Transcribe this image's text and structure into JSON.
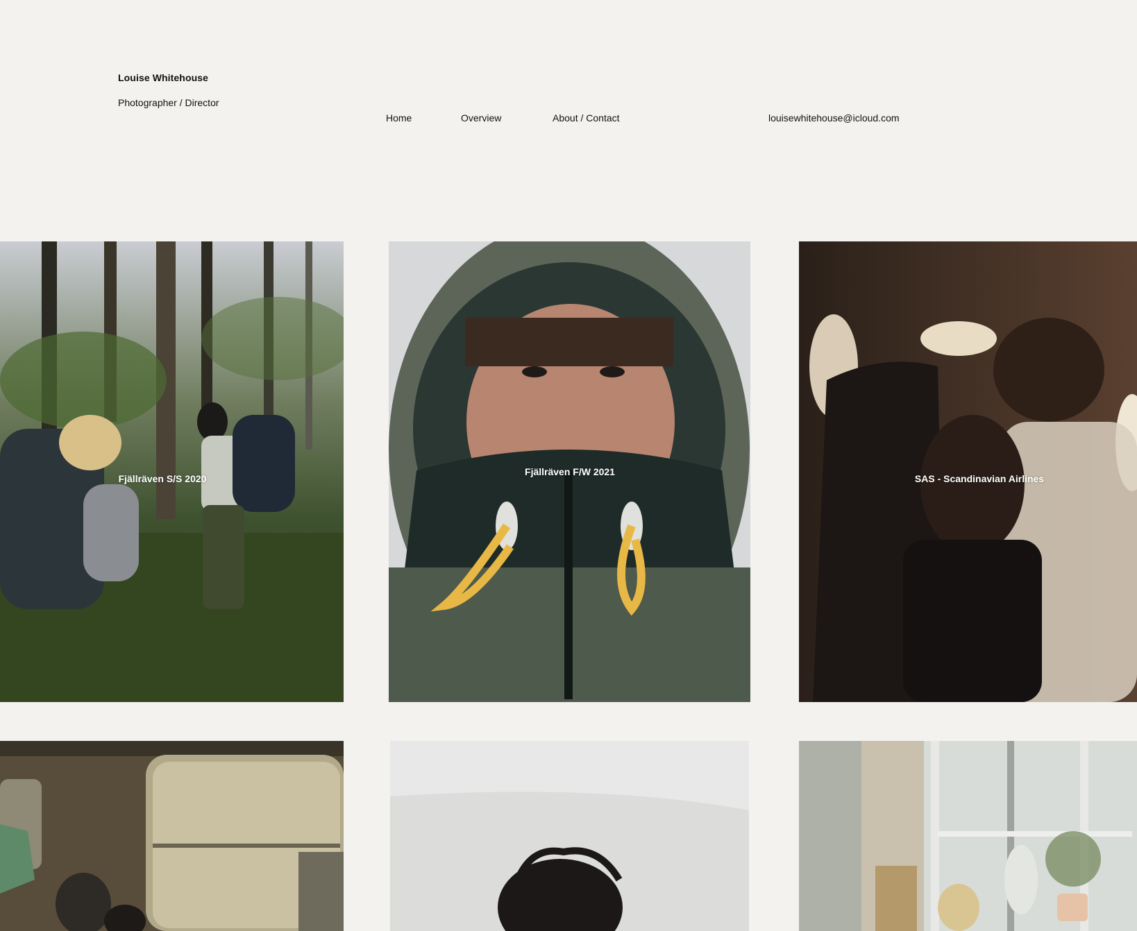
{
  "header": {
    "name": "Louise Whitehouse",
    "role": "Photographer / Director"
  },
  "nav": {
    "home": "Home",
    "overview": "Overview",
    "about_contact": "About / Contact",
    "email": "louisewhitehouse@icloud.com"
  },
  "projects": [
    {
      "title": "Fjällräven S/S 2020"
    },
    {
      "title": "Fjällräven F/W 2021"
    },
    {
      "title": "SAS - Scandinavian Airlines"
    },
    {
      "title": ""
    },
    {
      "title": ""
    },
    {
      "title": ""
    }
  ]
}
